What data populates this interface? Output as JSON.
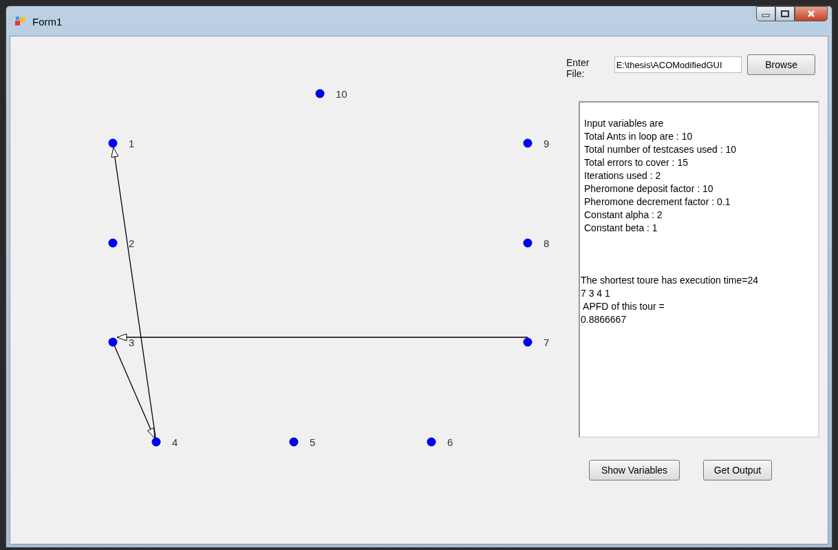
{
  "window": {
    "title": "Form1"
  },
  "graph": {
    "nodes": [
      {
        "label": "10"
      },
      {
        "label": "1"
      },
      {
        "label": "9"
      },
      {
        "label": "2"
      },
      {
        "label": "8"
      },
      {
        "label": "3"
      },
      {
        "label": "7"
      },
      {
        "label": "4"
      },
      {
        "label": "5"
      },
      {
        "label": "6"
      }
    ]
  },
  "file": {
    "label": "Enter File:",
    "value": "E:\\thesis\\ACOModifiedGUI",
    "button": "Browse"
  },
  "output": {
    "variables": [
      "Input variables are",
      "Total Ants in loop are : 10",
      "Total number of testcases used : 10",
      "Total errors to cover : 15",
      "Iterations used : 2",
      "Pheromone deposit factor : 10",
      "Pheromone decrement factor : 0.1",
      "Constant alpha : 2",
      "Constant beta : 1"
    ],
    "result": [
      "The shortest toure has execution time=24",
      "7 3 4 1",
      " APFD of this tour =",
      "0.8866667"
    ]
  },
  "buttons": [
    "Show Variables",
    "Get Output"
  ]
}
